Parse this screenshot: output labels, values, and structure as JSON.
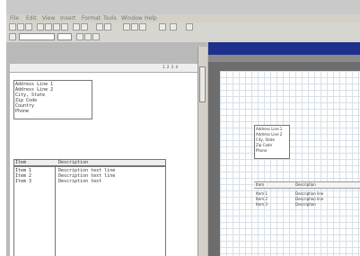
{
  "menu": [
    "File",
    "Edit",
    "View",
    "Insert",
    "Format",
    "Tools",
    "Window",
    "Help"
  ],
  "toolbar": {
    "icons": [
      "new-icon",
      "open-icon",
      "save-icon",
      "print-icon",
      "cut-icon",
      "copy-icon",
      "paste-icon",
      "undo-icon",
      "redo-icon",
      "find-icon",
      "zoom-icon",
      "grid-icon",
      "bold-icon",
      "italic-icon",
      "align-icon"
    ]
  },
  "left_report": {
    "ruler_text": "1 2 3 4",
    "address_lines": [
      "Address Line 1",
      "Address Line 2",
      "City, State",
      "Zip Code",
      "Country",
      "Phone"
    ],
    "table_headers": [
      "Item",
      "Description"
    ],
    "table_rows": [
      [
        "Item 1",
        "Description text line"
      ],
      [
        "Item 2",
        "Description text line"
      ],
      [
        "Item 3",
        "Description text"
      ]
    ]
  },
  "preview": {
    "address_lines": [
      "Address Line 1",
      "Address Line 2",
      "City, State",
      "Zip Code",
      "Phone"
    ],
    "table_headers": [
      "Item",
      "Description"
    ],
    "table_rows": [
      [
        "Item 1",
        "Description line"
      ],
      [
        "Item 2",
        "Description line"
      ],
      [
        "Item 3",
        "Description"
      ]
    ]
  }
}
